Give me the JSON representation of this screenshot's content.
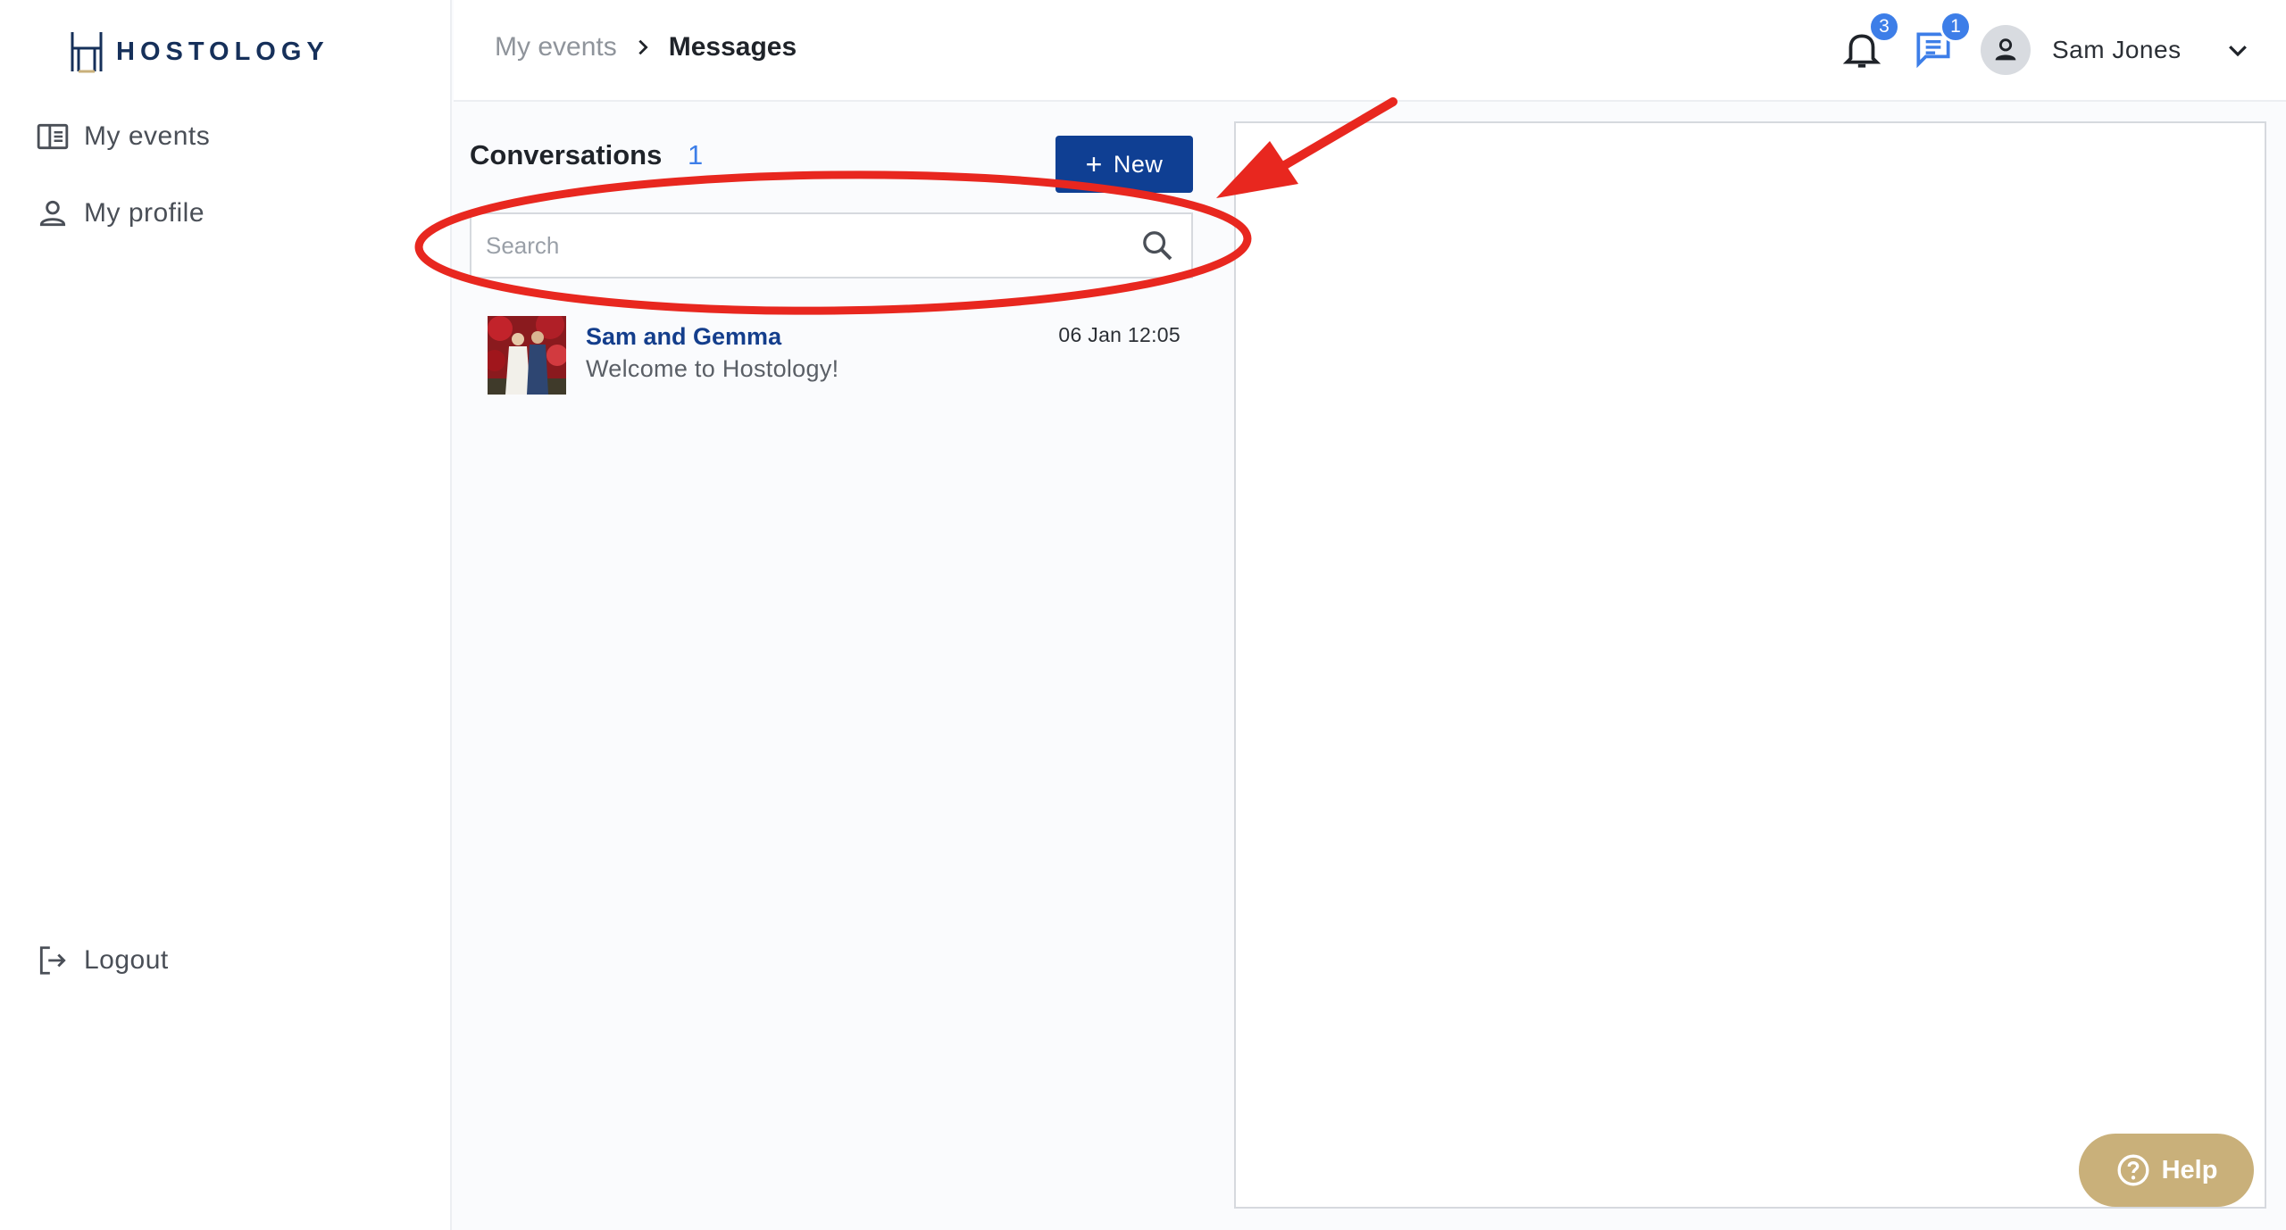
{
  "app": {
    "brand": "HOSTOLOGY"
  },
  "sidebar": {
    "items": [
      {
        "label": "My events",
        "icon": "book-open-icon"
      },
      {
        "label": "My profile",
        "icon": "person-icon"
      }
    ],
    "logout": {
      "label": "Logout",
      "icon": "logout-icon"
    }
  },
  "header": {
    "breadcrumb": {
      "parent": "My events",
      "current": "Messages"
    },
    "notifications": {
      "count": "3",
      "icon": "bell-icon"
    },
    "messages": {
      "count": "1",
      "icon": "chat-icon"
    },
    "user": {
      "name": "Sam Jones",
      "icon": "user-avatar-icon"
    }
  },
  "conversations": {
    "title": "Conversations",
    "count": "1",
    "new_label": "New",
    "search": {
      "placeholder": "Search",
      "value": ""
    },
    "items": [
      {
        "name": "Sam and Gemma",
        "preview": "Welcome to Hostology!",
        "time": "06 Jan 12:05"
      }
    ]
  },
  "help": {
    "label": "Help"
  },
  "colors": {
    "primary": "#0f3f93",
    "accent": "#3d7ee8",
    "help": "#c9b07a",
    "annotation": "#e8271f"
  }
}
